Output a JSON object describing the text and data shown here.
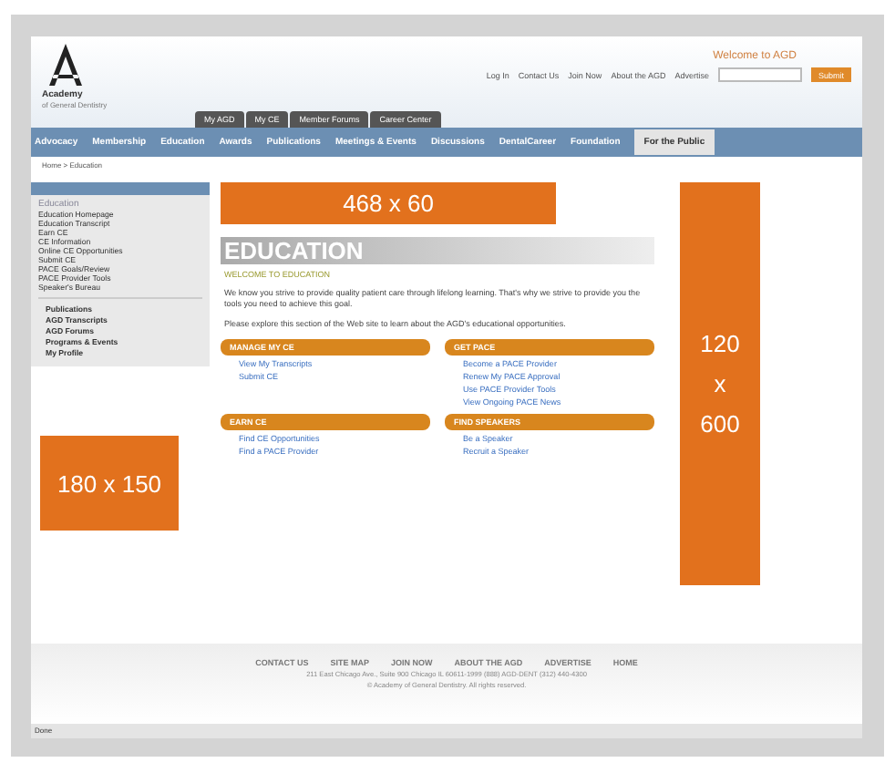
{
  "header": {
    "welcome": "Welcome to AGD",
    "links": [
      "Log In",
      "Contact Us",
      "Join Now",
      "About the AGD",
      "Advertise"
    ],
    "search": {
      "button": "Submit"
    },
    "logo": {
      "name": "Academy",
      "tagline": "of General Dentistry"
    }
  },
  "member_tabs": [
    "My AGD",
    "My CE",
    "Member Forums",
    "Career Center"
  ],
  "nav": [
    {
      "label": "Advocacy",
      "selected": false
    },
    {
      "label": "Membership",
      "selected": false
    },
    {
      "label": "Education",
      "selected": false
    },
    {
      "label": "Awards",
      "selected": false
    },
    {
      "label": "Publications",
      "selected": false
    },
    {
      "label": "Meetings & Events",
      "selected": false
    },
    {
      "label": "Discussions",
      "selected": false
    },
    {
      "label": "DentalCareer",
      "selected": false
    },
    {
      "label": "Foundation",
      "selected": false
    },
    {
      "label": "For the Public",
      "selected": true
    }
  ],
  "breadcrumb": "Home > Education",
  "sidebar": {
    "title": "Education",
    "items": [
      "Education Homepage",
      "Education Transcript",
      "Earn CE",
      "CE Information",
      "Online CE Opportunities",
      "Submit CE",
      "PACE Goals/Review",
      "PACE Provider Tools",
      "Speaker's Bureau"
    ],
    "bold_items": [
      "Publications",
      "AGD Transcripts",
      "AGD Forums",
      "Programs & Events",
      "My Profile"
    ]
  },
  "ads": [
    {
      "label": "468 x 60"
    },
    {
      "label": "120\nx\n600"
    },
    {
      "label": "180 x 150"
    }
  ],
  "main": {
    "title": "EDUCATION",
    "subtitle": "WELCOME TO EDUCATION",
    "paragraphs": [
      "We know you strive to provide quality patient care through lifelong learning. That's why we strive to provide you the tools you need to achieve this goal.",
      "Please explore this section of the Web site to learn about the AGD's educational opportunities."
    ],
    "sections": [
      {
        "title": "MANAGE MY CE",
        "links": [
          "View My Transcripts",
          "Submit CE"
        ]
      },
      {
        "title": "GET PACE",
        "links": [
          "Become a PACE Provider",
          "Renew My PACE Approval",
          "Use PACE Provider Tools",
          "View Ongoing PACE News"
        ]
      },
      {
        "title": "EARN CE",
        "links": [
          "Find CE Opportunities",
          "Find a PACE Provider"
        ]
      },
      {
        "title": "FIND SPEAKERS",
        "links": [
          "Be a Speaker",
          "Recruit a Speaker"
        ]
      }
    ]
  },
  "footer": {
    "links": [
      "CONTACT US",
      "SITE MAP",
      "JOIN NOW",
      "ABOUT THE AGD",
      "ADVERTISE",
      "HOME"
    ],
    "address": "211 East Chicago Ave., Suite 900 Chicago IL 60611-1999 (888) AGD-DENT (312) 440-4300",
    "copyright": "© Academy of General Dentistry. All rights reserved."
  },
  "status_bar": "Done"
}
